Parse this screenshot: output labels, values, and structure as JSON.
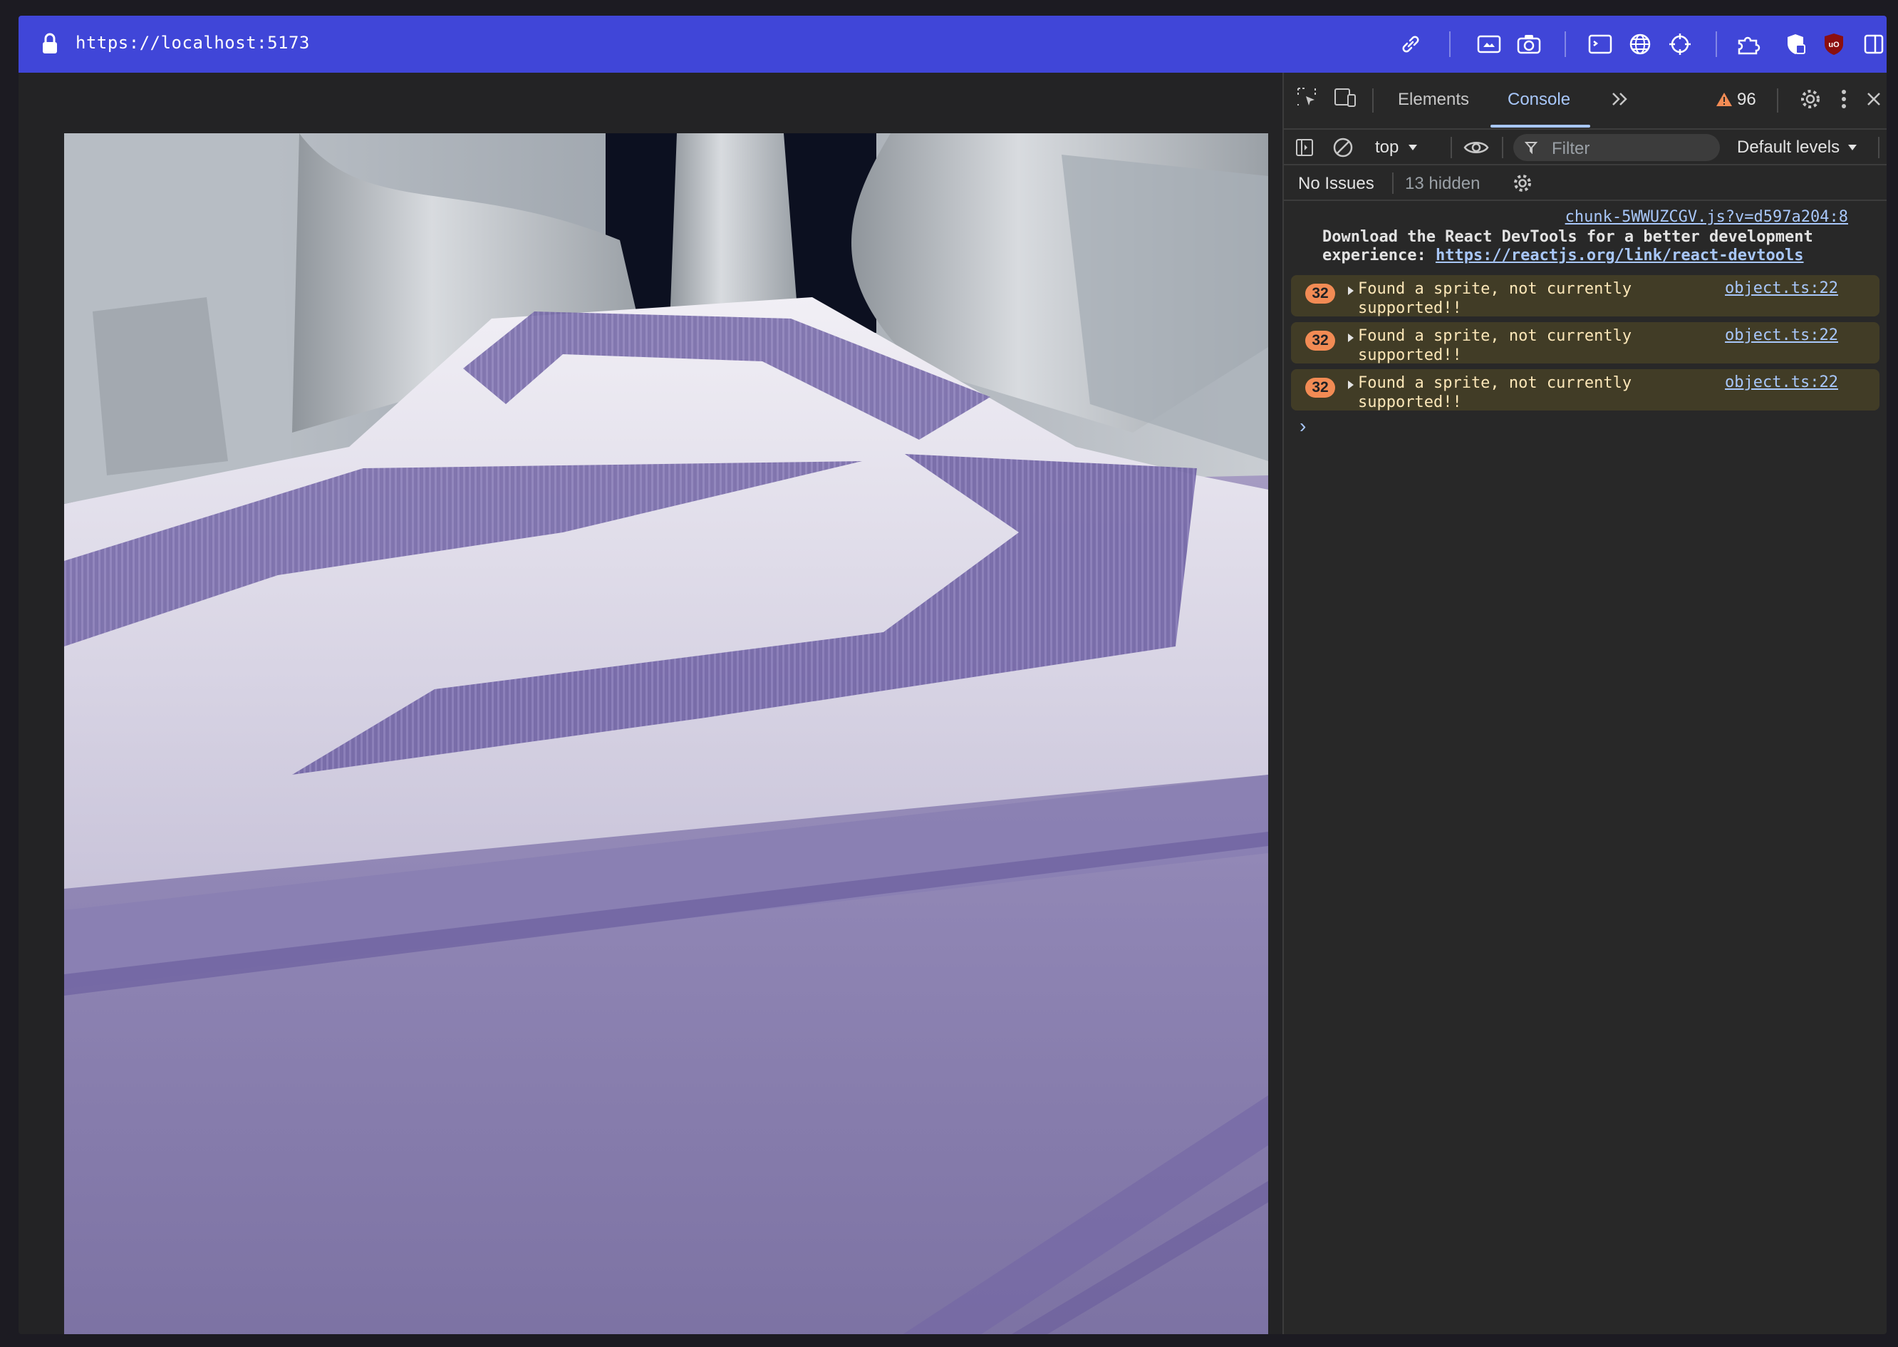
{
  "browser": {
    "url": "https://localhost:5173",
    "toolbar_icons": [
      "link-icon",
      "media-icon",
      "camera-icon",
      "terminal-icon",
      "globe-icon",
      "crosshair-icon",
      "extensions-icon",
      "shield-extension-icon",
      "ublock-icon",
      "sidebar-icon"
    ]
  },
  "devtools": {
    "tabs": [
      {
        "label": "Elements",
        "active": false
      },
      {
        "label": "Console",
        "active": true
      }
    ],
    "warning_count": "96",
    "context": "top",
    "filter_placeholder": "Filter",
    "levels": "Default levels",
    "issues": "No Issues",
    "hidden": "13 hidden",
    "console": {
      "info": {
        "source": "chunk-5WWUZCGV.js?v=d597a204:8",
        "text": "Download the React DevTools for a better development experience:",
        "link": "https://reactjs.org/link/react-devtools"
      },
      "warnings": [
        {
          "count": "32",
          "text": "Found a sprite, not currently supported!!",
          "source": "object.ts:22"
        },
        {
          "count": "32",
          "text": "Found a sprite, not currently supported!!",
          "source": "object.ts:22"
        },
        {
          "count": "32",
          "text": "Found a sprite, not currently supported!!",
          "source": "object.ts:22"
        }
      ],
      "prompt": "›"
    }
  },
  "colors": {
    "url_bar": "#4046d8",
    "devtools_bg": "#282828",
    "accent": "#a8c7fa",
    "warning_bg": "#413c26",
    "warning_text": "#fce7b8",
    "badge": "#f28b54",
    "scene_purple": "#8a7fae"
  }
}
